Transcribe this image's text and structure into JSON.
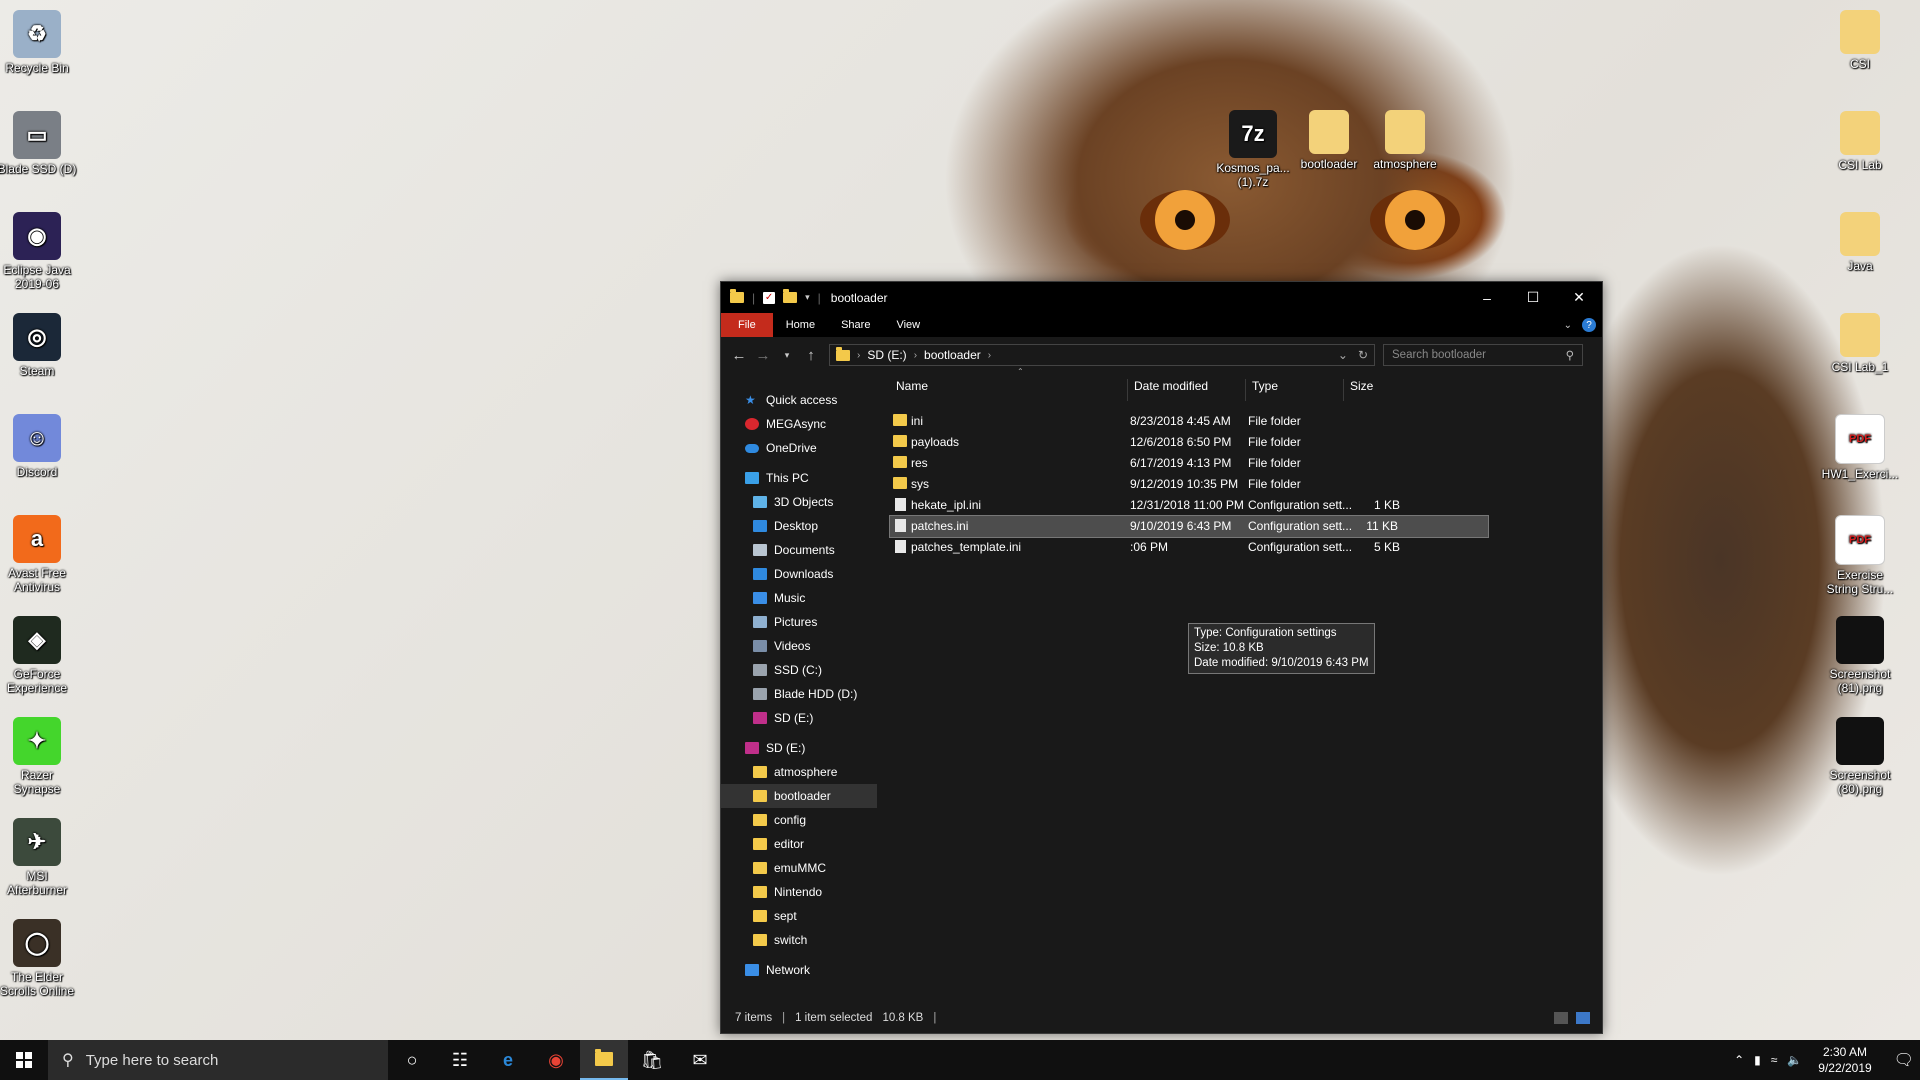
{
  "desktop": {
    "left_icons": [
      {
        "label": "Recycle Bin",
        "icon": "recycle-bin-icon",
        "color": "#9ab0c8",
        "glyph": "♻"
      },
      {
        "label": "Blade SSD (D)",
        "icon": "drive-icon",
        "color": "#7a7f86",
        "glyph": "▭"
      },
      {
        "label": "Eclipse Java 2019-06",
        "icon": "eclipse-icon",
        "color": "#2c2255",
        "glyph": "◉"
      },
      {
        "label": "Steam",
        "icon": "steam-icon",
        "color": "#1b2838",
        "glyph": "◎"
      },
      {
        "label": "Discord",
        "icon": "discord-icon",
        "color": "#7289da",
        "glyph": "☺"
      },
      {
        "label": "Avast Free Antivirus",
        "icon": "avast-icon",
        "color": "#f26a1b",
        "glyph": "a"
      },
      {
        "label": "GeForce Experience",
        "icon": "geforce-icon",
        "color": "#1f2a1f",
        "glyph": "◈"
      },
      {
        "label": "Razer Synapse",
        "icon": "razer-icon",
        "color": "#44d62c",
        "glyph": "✦"
      },
      {
        "label": "MSI Afterburner",
        "icon": "msi-icon",
        "color": "#3c4a3c",
        "glyph": "✈"
      },
      {
        "label": "The Elder Scrolls Online",
        "icon": "eso-icon",
        "color": "#3a3026",
        "glyph": "◯"
      }
    ],
    "right_icons": [
      {
        "label": "CSI",
        "icon": "folder-icon",
        "color": "#f3d27a",
        "glyph": ""
      },
      {
        "label": "CSI Lab",
        "icon": "folder-icon",
        "color": "#f3d27a",
        "glyph": ""
      },
      {
        "label": "Java",
        "icon": "folder-icon",
        "color": "#f3d27a",
        "glyph": ""
      },
      {
        "label": "CSI Lab_1",
        "icon": "folder-icon",
        "color": "#f3d27a",
        "glyph": ""
      },
      {
        "label": "HW1_Exerci...",
        "icon": "pdf-icon",
        "color": "#ffffff",
        "glyph": "PDF"
      },
      {
        "label": "Exercise String Stru...",
        "icon": "pdf-icon",
        "color": "#ffffff",
        "glyph": "PDF"
      },
      {
        "label": "Screenshot (81).png",
        "icon": "image-file-icon",
        "color": "#111111",
        "glyph": ""
      },
      {
        "label": "Screenshot (80).png",
        "icon": "image-file-icon",
        "color": "#111111",
        "glyph": ""
      }
    ],
    "top_icons": [
      {
        "label": "Kosmos_pa... (1).7z",
        "icon": "7zip-icon",
        "color": "#1a1a1a",
        "glyph": "7z"
      },
      {
        "label": "bootloader",
        "icon": "folder-icon",
        "color": "#f3d27a",
        "glyph": ""
      },
      {
        "label": "atmosphere",
        "icon": "folder-icon",
        "color": "#f3d27a",
        "glyph": ""
      }
    ]
  },
  "explorer": {
    "title": "bootloader",
    "ribbon_tabs": [
      "File",
      "Home",
      "Share",
      "View"
    ],
    "breadcrumb": [
      "SD (E:)",
      "bootloader"
    ],
    "search_placeholder": "Search bootloader",
    "nav": [
      {
        "label": "Quick access",
        "icon": "star-icon",
        "color": "#3a8ee6",
        "indent": 0
      },
      {
        "label": "MEGAsync",
        "icon": "mega-icon",
        "color": "#d9272e",
        "indent": 0
      },
      {
        "label": "OneDrive",
        "icon": "cloud-icon",
        "color": "#2f8ae0",
        "indent": 0
      },
      {
        "label": "This PC",
        "icon": "pc-icon",
        "color": "#3aa0e8",
        "indent": 0
      },
      {
        "label": "3D Objects",
        "icon": "cube-icon",
        "color": "#5fb3e8",
        "indent": 1
      },
      {
        "label": "Desktop",
        "icon": "desktop-icon",
        "color": "#2f8ae0",
        "indent": 1
      },
      {
        "label": "Documents",
        "icon": "document-icon",
        "color": "#b8c4d0",
        "indent": 1
      },
      {
        "label": "Downloads",
        "icon": "download-icon",
        "color": "#2f8ae0",
        "indent": 1
      },
      {
        "label": "Music",
        "icon": "music-icon",
        "color": "#3a8ee6",
        "indent": 1
      },
      {
        "label": "Pictures",
        "icon": "pictures-icon",
        "color": "#8fb0d0",
        "indent": 1
      },
      {
        "label": "Videos",
        "icon": "video-icon",
        "color": "#7a8ea8",
        "indent": 1
      },
      {
        "label": "SSD (C:)",
        "icon": "drive-icon",
        "color": "#9aa3ad",
        "indent": 1
      },
      {
        "label": "Blade HDD (D:)",
        "icon": "drive-icon",
        "color": "#9aa3ad",
        "indent": 1
      },
      {
        "label": "SD (E:)",
        "icon": "sd-icon",
        "color": "#c02f8a",
        "indent": 1
      },
      {
        "label": "SD (E:)",
        "icon": "sd-icon",
        "color": "#c02f8a",
        "indent": 0
      },
      {
        "label": "atmosphere",
        "icon": "folder-icon",
        "color": "#f3c94a",
        "indent": 1
      },
      {
        "label": "bootloader",
        "icon": "folder-icon",
        "color": "#f3c94a",
        "indent": 1
      },
      {
        "label": "config",
        "icon": "folder-icon",
        "color": "#f3c94a",
        "indent": 1
      },
      {
        "label": "editor",
        "icon": "folder-icon",
        "color": "#f3c94a",
        "indent": 1
      },
      {
        "label": "emuMMC",
        "icon": "folder-icon",
        "color": "#f3c94a",
        "indent": 1
      },
      {
        "label": "Nintendo",
        "icon": "folder-icon",
        "color": "#f3c94a",
        "indent": 1
      },
      {
        "label": "sept",
        "icon": "folder-icon",
        "color": "#f3c94a",
        "indent": 1
      },
      {
        "label": "switch",
        "icon": "folder-icon",
        "color": "#f3c94a",
        "indent": 1
      },
      {
        "label": "Network",
        "icon": "network-icon",
        "color": "#3a8ee6",
        "indent": 0
      }
    ],
    "selected_nav": "bootloader",
    "columns": [
      "Name",
      "Date modified",
      "Type",
      "Size"
    ],
    "files": [
      {
        "name": "ini",
        "date": "8/23/2018 4:45 AM",
        "type": "File folder",
        "size": "",
        "icon": "folder-icon"
      },
      {
        "name": "payloads",
        "date": "12/6/2018 6:50 PM",
        "type": "File folder",
        "size": "",
        "icon": "folder-icon"
      },
      {
        "name": "res",
        "date": "6/17/2019 4:13 PM",
        "type": "File folder",
        "size": "",
        "icon": "folder-icon"
      },
      {
        "name": "sys",
        "date": "9/12/2019 10:35 PM",
        "type": "File folder",
        "size": "",
        "icon": "folder-icon"
      },
      {
        "name": "hekate_ipl.ini",
        "date": "12/31/2018 11:00 PM",
        "type": "Configuration sett...",
        "size": "1 KB",
        "icon": "config-file-icon"
      },
      {
        "name": "patches.ini",
        "date": "9/10/2019 6:43 PM",
        "type": "Configuration sett...",
        "size": "11 KB",
        "icon": "config-file-icon",
        "selected": true
      },
      {
        "name": "patches_template.ini",
        "date": ":06 PM",
        "type": "Configuration sett...",
        "size": "5 KB",
        "icon": "config-file-icon"
      }
    ],
    "tooltip": [
      "Type: Configuration settings",
      "Size: 10.8 KB",
      "Date modified: 9/10/2019 6:43 PM"
    ],
    "status": {
      "items": "7 items",
      "selected": "1 item selected",
      "size": "10.8 KB"
    }
  },
  "taskbar": {
    "search_placeholder": "Type here to search",
    "time": "2:30 AM",
    "date": "9/22/2019"
  }
}
